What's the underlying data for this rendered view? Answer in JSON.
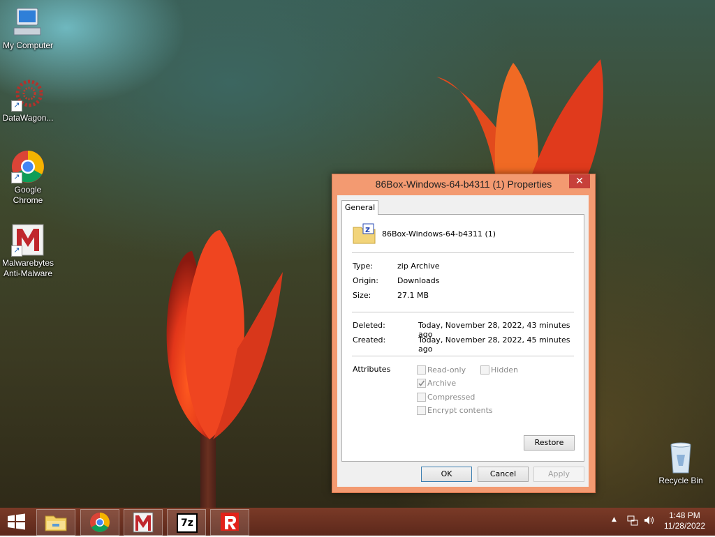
{
  "desktop": {
    "icons": [
      {
        "label": "My Computer",
        "icon": "computer-icon"
      },
      {
        "label": "DataWagon...",
        "icon": "datawagon-icon"
      },
      {
        "label": "Google Chrome",
        "icon": "chrome-icon"
      },
      {
        "label": "Malwarebytes Anti-Malware",
        "icon": "malwarebytes-icon"
      },
      {
        "label": "Recycle Bin",
        "icon": "recycle-bin-icon"
      }
    ]
  },
  "dialog": {
    "title": "86Box-Windows-64-b4311 (1) Properties",
    "close": "✕",
    "tab": "General",
    "file_name": "86Box-Windows-64-b4311 (1)",
    "type_label": "Type:",
    "type_value": "zip Archive",
    "origin_label": "Origin:",
    "origin_value": "Downloads",
    "size_label": "Size:",
    "size_value": "27.1 MB",
    "deleted_label": "Deleted:",
    "deleted_value": "Today, November 28, 2022, 43 minutes ago",
    "created_label": "Created:",
    "created_value": "Today, November 28, 2022, 45 minutes ago",
    "attributes_label": "Attributes",
    "attributes": {
      "readonly": {
        "label": "Read-only",
        "checked": false
      },
      "hidden": {
        "label": "Hidden",
        "checked": false
      },
      "archive": {
        "label": "Archive",
        "checked": true
      },
      "compressed": {
        "label": "Compressed",
        "checked": false
      },
      "encrypt": {
        "label": "Encrypt contents",
        "checked": false
      }
    },
    "restore": "Restore",
    "ok": "OK",
    "cancel": "Cancel",
    "apply": "Apply"
  },
  "taskbar": {
    "apps": [
      "file-explorer-icon",
      "chrome-icon",
      "malwarebytes-icon",
      "7zip-icon",
      "roblox-icon"
    ],
    "seven_zip": "7z",
    "time": "1:48 PM",
    "date": "11/28/2022"
  }
}
